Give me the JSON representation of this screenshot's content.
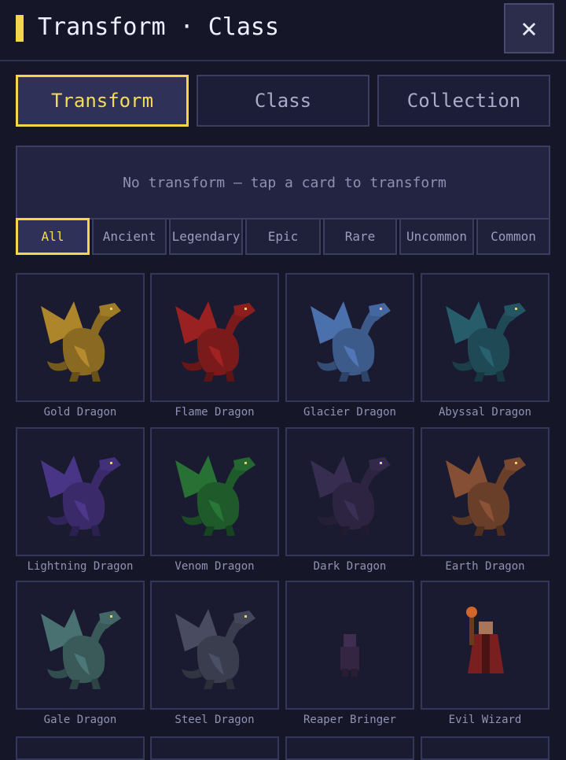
{
  "header": {
    "title": "Transform · Class",
    "close_symbol": "✕"
  },
  "tabs": [
    {
      "label": "Transform",
      "active": true
    },
    {
      "label": "Class",
      "active": false
    },
    {
      "label": "Collection",
      "active": false
    }
  ],
  "status": {
    "text": "No transform — tap a card to transform"
  },
  "filters": [
    {
      "label": "All",
      "active": true
    },
    {
      "label": "Ancient",
      "active": false
    },
    {
      "label": "Legendary",
      "active": false
    },
    {
      "label": "Epic",
      "active": false
    },
    {
      "label": "Rare",
      "active": false
    },
    {
      "label": "Uncommon",
      "active": false
    },
    {
      "label": "Common",
      "active": false
    }
  ],
  "cards": [
    {
      "name": "Gold Dragon",
      "icon": "gold-dragon-icon",
      "color": "#8a6a22"
    },
    {
      "name": "Flame Dragon",
      "icon": "flame-dragon-icon",
      "color": "#7a1a1a"
    },
    {
      "name": "Glacier Dragon",
      "icon": "glacier-dragon-icon",
      "color": "#3c5a8a"
    },
    {
      "name": "Abyssal Dragon",
      "icon": "abyssal-dragon-icon",
      "color": "#1f4a55"
    },
    {
      "name": "Lightning Dragon",
      "icon": "lightning-dragon-icon",
      "color": "#3a2a6a"
    },
    {
      "name": "Venom Dragon",
      "icon": "venom-dragon-icon",
      "color": "#1f5a2a"
    },
    {
      "name": "Dark Dragon",
      "icon": "dark-dragon-icon",
      "color": "#2c2440"
    },
    {
      "name": "Earth Dragon",
      "icon": "earth-dragon-icon",
      "color": "#6a3f2a"
    },
    {
      "name": "Gale Dragon",
      "icon": "gale-dragon-icon",
      "color": "#3a5a5a"
    },
    {
      "name": "Steel Dragon",
      "icon": "steel-dragon-icon",
      "color": "#3a3d4d"
    },
    {
      "name": "Reaper Bringer",
      "icon": "reaper-bringer-icon",
      "color": "#3a2a4a"
    },
    {
      "name": "Evil Wizard",
      "icon": "evil-wizard-icon",
      "color": "#7a1f1f"
    }
  ],
  "colors": {
    "accent": "#f3d64a",
    "background": "#161629",
    "panel": "#232442",
    "border": "#3b3e60"
  }
}
